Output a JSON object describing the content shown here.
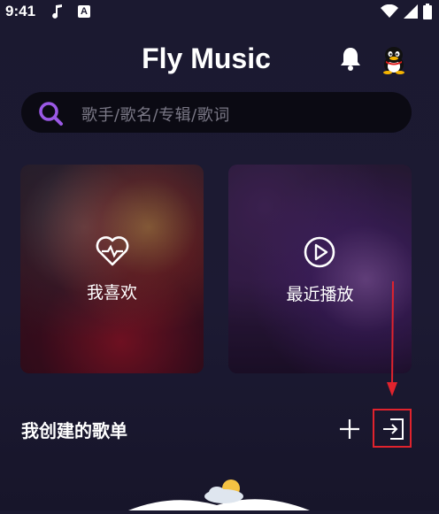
{
  "status": {
    "time": "9:41"
  },
  "app": {
    "title": "Fly Music"
  },
  "search": {
    "placeholder": "歌手/歌名/专辑/歌词"
  },
  "cards": [
    {
      "label": "我喜欢",
      "icon": "heart-pulse-icon"
    },
    {
      "label": "最近播放",
      "icon": "play-circle-icon"
    }
  ],
  "section": {
    "title": "我创建的歌单"
  },
  "colors": {
    "accent": "#9b59e6",
    "highlight": "#e0232d",
    "background": "#1b1930"
  }
}
